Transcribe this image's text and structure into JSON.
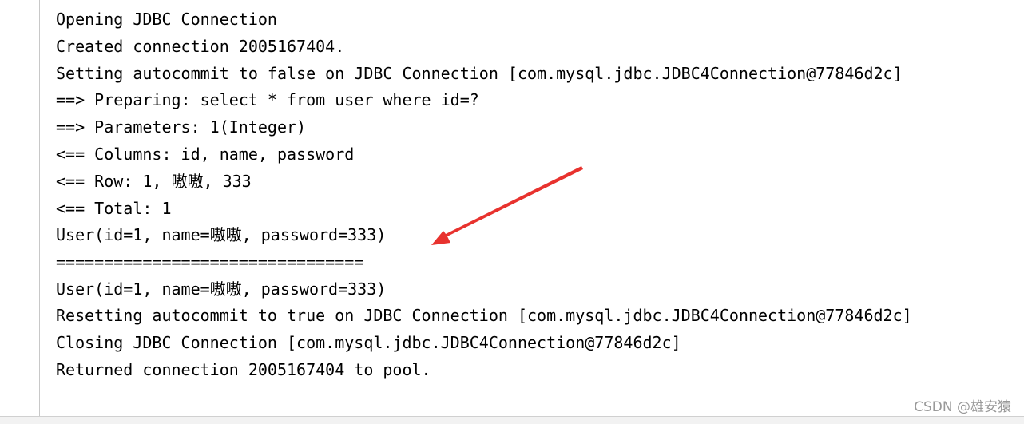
{
  "console": {
    "lines": [
      "Opening JDBC Connection",
      "Created connection 2005167404.",
      "Setting autocommit to false on JDBC Connection [com.mysql.jdbc.JDBC4Connection@77846d2c]",
      "==>  Preparing: select * from user where id=?",
      "==> Parameters: 1(Integer)",
      "<==    Columns: id, name, password",
      "<==        Row: 1, 嗷嗷, 333",
      "<==      Total: 1",
      "User(id=1, name=嗷嗷, password=333)",
      "================================",
      "User(id=1, name=嗷嗷, password=333)",
      "Resetting autocommit to true on JDBC Connection [com.mysql.jdbc.JDBC4Connection@77846d2c]",
      "Closing JDBC Connection [com.mysql.jdbc.JDBC4Connection@77846d2c]",
      "Returned connection 2005167404 to pool."
    ]
  },
  "annotation": {
    "arrow_color": "#e8322e"
  },
  "watermark": "CSDN @雄安猿"
}
